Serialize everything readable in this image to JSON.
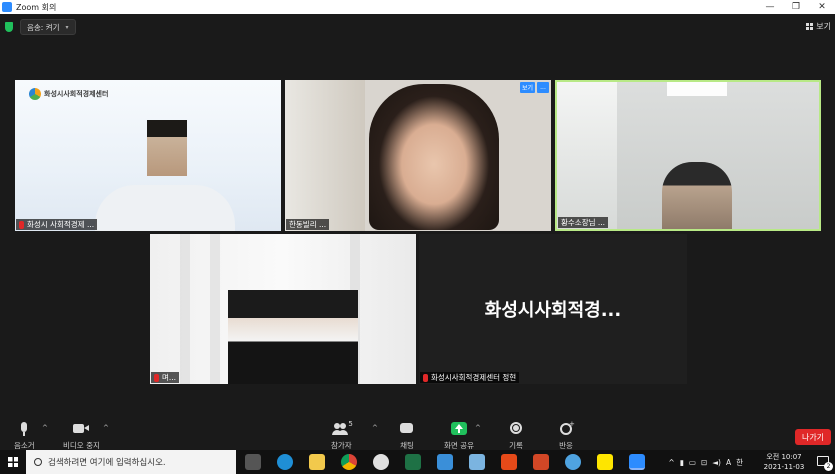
{
  "window": {
    "title": "Zoom 회의",
    "min": "—",
    "restore": "❐",
    "close": "✕"
  },
  "topbar": {
    "recording_label": "음송: 켜기",
    "view_label": "보기"
  },
  "tiles": {
    "t1": {
      "name": "화성시 사회적경제 ...",
      "logo_text": "화성시사회적경제센터"
    },
    "t2": {
      "name": "한동빌리 ...",
      "btn1": "보기",
      "btn2": "..."
    },
    "t3": {
      "name": "황수소장님 ..."
    },
    "t4": {
      "name": "며..."
    },
    "t5": {
      "display_name": "화성시사회적경...",
      "name": "화성시사회적경제센터 정현"
    }
  },
  "toolbar": {
    "mute": "음소거",
    "video": "비디오 중지",
    "participants": "참가자",
    "participants_count": "5",
    "chat": "채팅",
    "share": "화면 공유",
    "record": "기록",
    "reactions": "반응",
    "leave": "나가기"
  },
  "taskbar": {
    "search_placeholder": "검색하려면 여기에 입력하십시오.",
    "ime": "A",
    "ime2": "한",
    "time": "오전 10:07",
    "date": "2021-11-03",
    "notifications": "2"
  }
}
